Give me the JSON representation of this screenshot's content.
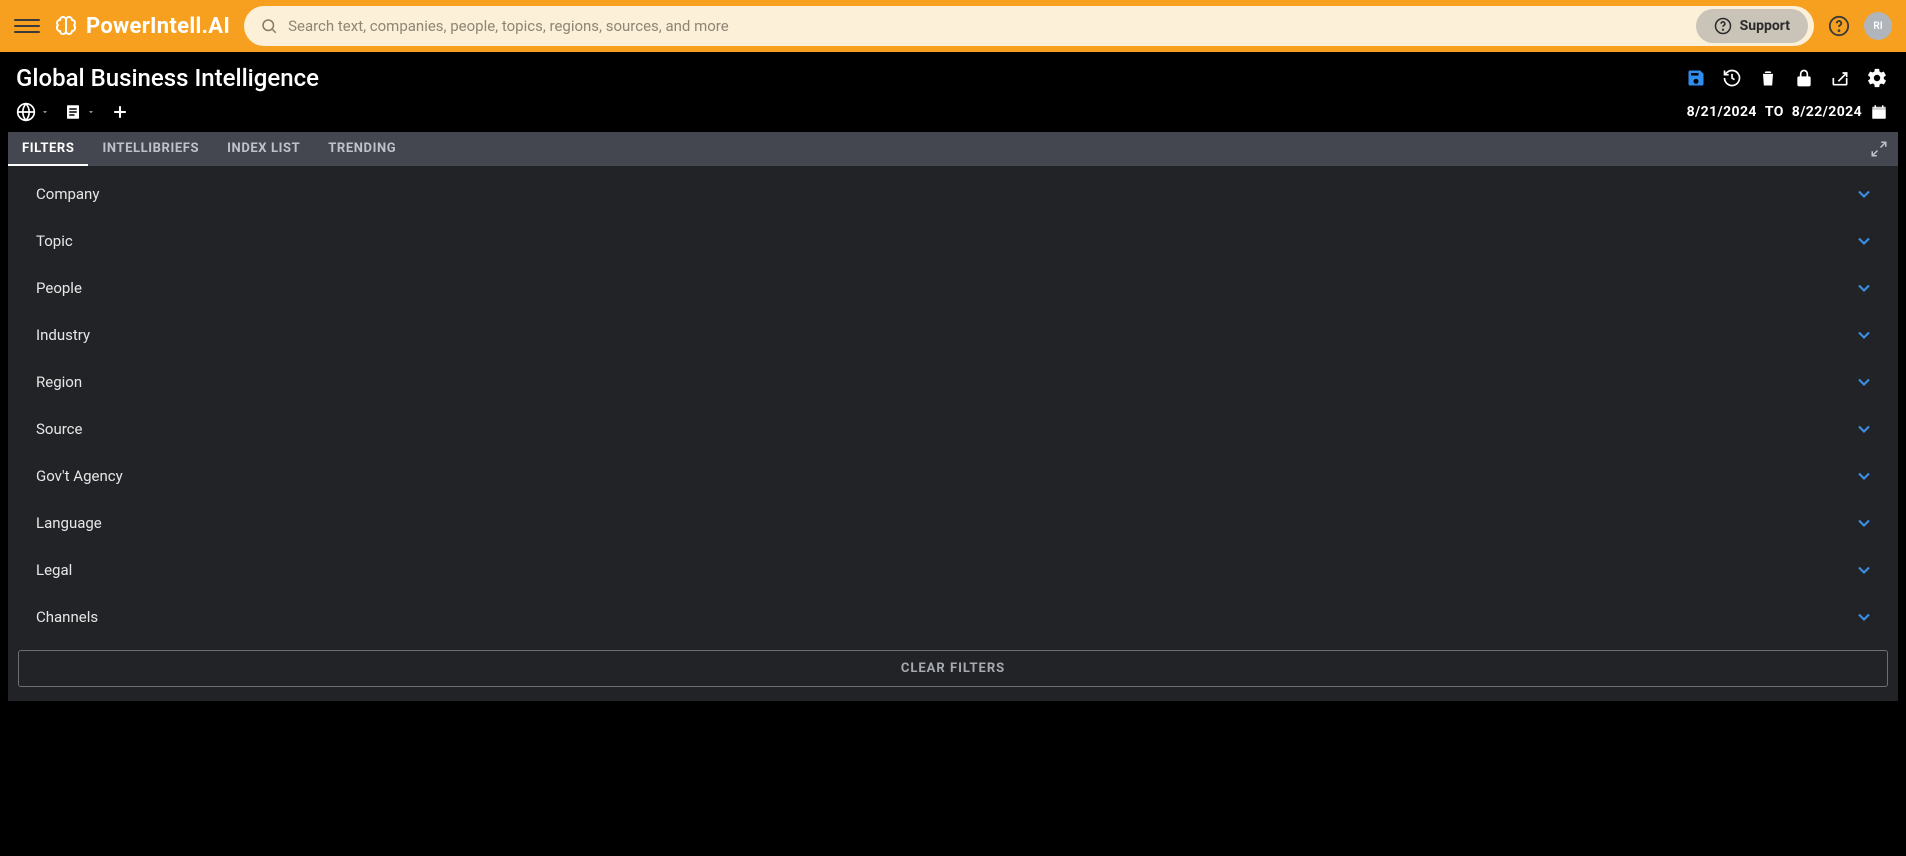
{
  "brand": {
    "name": "PowerIntell.AI"
  },
  "search": {
    "placeholder": "Search text, companies, people, topics, regions, sources, and more"
  },
  "support": {
    "label": "Support"
  },
  "avatar": {
    "initials": "RI"
  },
  "page": {
    "title": "Global Business Intelligence"
  },
  "dateRange": {
    "from": "8/21/2024",
    "to_word": "TO",
    "to": "8/22/2024"
  },
  "tabs": [
    {
      "label": "FILTERS",
      "active": true
    },
    {
      "label": "INTELLIBRIEFS",
      "active": false
    },
    {
      "label": "INDEX LIST",
      "active": false
    },
    {
      "label": "TRENDING",
      "active": false
    }
  ],
  "filters": [
    {
      "label": "Company"
    },
    {
      "label": "Topic"
    },
    {
      "label": "People"
    },
    {
      "label": "Industry"
    },
    {
      "label": "Region"
    },
    {
      "label": "Source"
    },
    {
      "label": "Gov't Agency"
    },
    {
      "label": "Language"
    },
    {
      "label": "Legal"
    },
    {
      "label": "Channels"
    }
  ],
  "clearFilters": {
    "label": "CLEAR FILTERS"
  }
}
